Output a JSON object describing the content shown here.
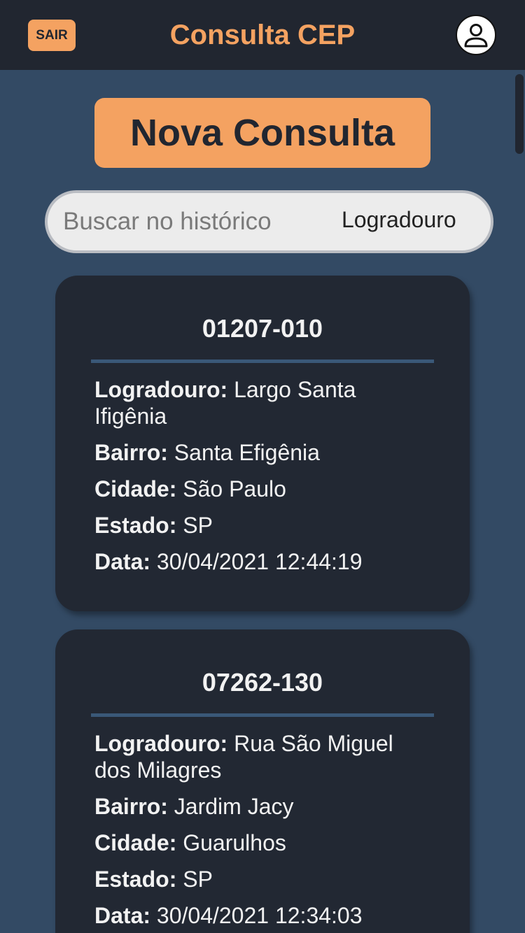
{
  "header": {
    "logout_label": "SAIR",
    "title": "Consulta CEP",
    "avatar_icon": "user-icon"
  },
  "actions": {
    "new_query_label": "Nova Consulta"
  },
  "search": {
    "placeholder": "Buscar no histórico",
    "filter_selected": "Logradouro"
  },
  "history": [
    {
      "cep": "01207-010",
      "logradouro_label": "Logradouro:",
      "logradouro": "Largo Santa Ifigênia",
      "bairro_label": "Bairro:",
      "bairro": "Santa Efigênia",
      "cidade_label": "Cidade:",
      "cidade": "São Paulo",
      "estado_label": "Estado:",
      "estado": "SP",
      "data_label": "Data:",
      "data": "30/04/2021 12:44:19"
    },
    {
      "cep": "07262-130",
      "logradouro_label": "Logradouro:",
      "logradouro": "Rua São Miguel dos Milagres",
      "bairro_label": "Bairro:",
      "bairro": "Jardim Jacy",
      "cidade_label": "Cidade:",
      "cidade": "Guarulhos",
      "estado_label": "Estado:",
      "estado": "SP",
      "data_label": "Data:",
      "data": "30/04/2021 12:34:03"
    }
  ],
  "colors": {
    "accent": "#f4a261",
    "background": "#334a64",
    "header": "#212630",
    "card": "#222833"
  }
}
